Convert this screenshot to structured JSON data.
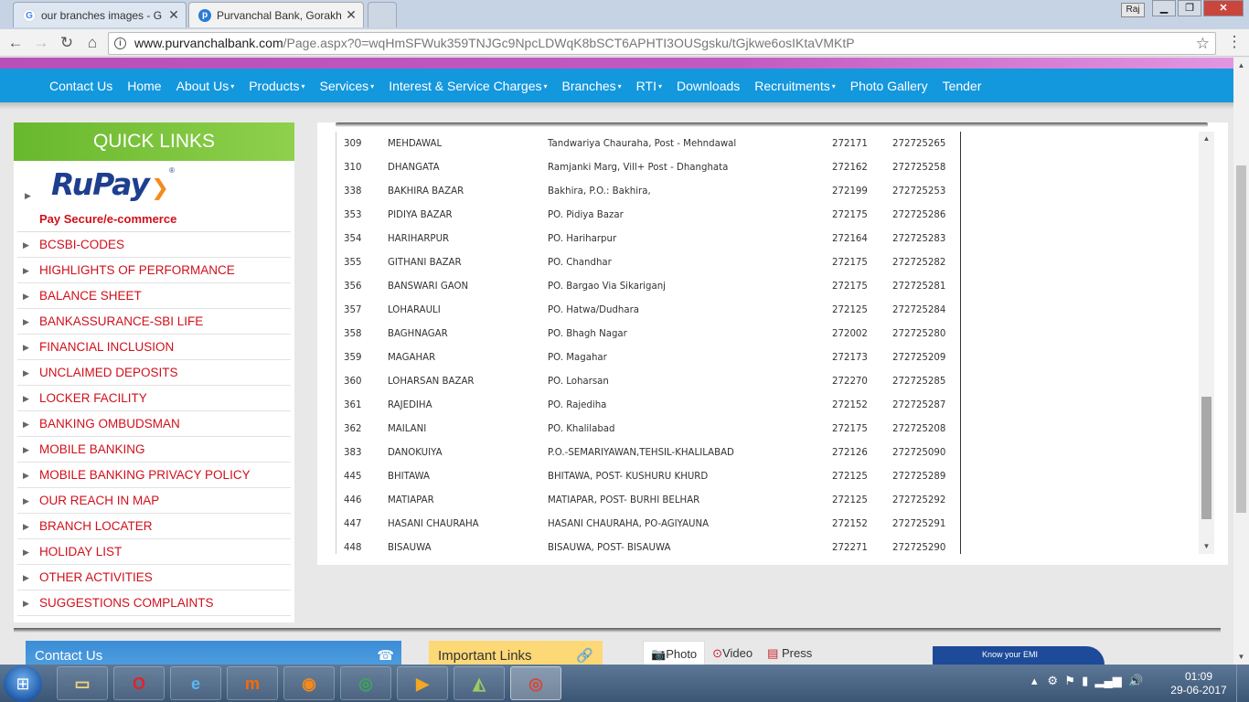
{
  "browser": {
    "tabs": [
      {
        "title": "our branches images - G",
        "favicon": "google-icon",
        "active": false
      },
      {
        "title": "Purvanchal Bank, Gorakh",
        "favicon": "pb-icon",
        "active": true
      }
    ],
    "profile": "Raj",
    "url_host": "www.purvanchalbank.com",
    "url_path": "/Page.aspx?0=wqHmSFWuk359TNJGc9NpcLDWqK8bSCT6APHTI3OUSgsku/tGjkwe6osIKtaVMKtP"
  },
  "nav": {
    "items": [
      {
        "label": "Contact Us",
        "dropdown": false
      },
      {
        "label": "Home",
        "dropdown": false
      },
      {
        "label": "About Us",
        "dropdown": true
      },
      {
        "label": "Products",
        "dropdown": true
      },
      {
        "label": "Services",
        "dropdown": true
      },
      {
        "label": "Interest & Service Charges",
        "dropdown": true
      },
      {
        "label": "Branches",
        "dropdown": true
      },
      {
        "label": "RTI",
        "dropdown": true
      },
      {
        "label": "Downloads",
        "dropdown": false
      },
      {
        "label": "Recruitments",
        "dropdown": true
      },
      {
        "label": "Photo Gallery",
        "dropdown": false
      },
      {
        "label": "Tender",
        "dropdown": false
      }
    ],
    "caret": "▾"
  },
  "quick_links": {
    "title": "QUICK LINKS",
    "rupay_logo": "RuPay",
    "rupay_caption": "Pay Secure/e-commerce",
    "items": [
      "BCSBI-CODES",
      "HIGHLIGHTS OF PERFORMANCE",
      "BALANCE SHEET",
      "BANKASSURANCE-SBI LIFE",
      "FINANCIAL INCLUSION",
      "UNCLAIMED DEPOSITS",
      "LOCKER FACILITY",
      "BANKING OMBUDSMAN",
      "MOBILE BANKING",
      "MOBILE BANKING PRIVACY POLICY",
      "OUR REACH IN MAP",
      "BRANCH LOCATER",
      "HOLIDAY LIST",
      "OTHER ACTIVITIES",
      "SUGGESTIONS COMPLAINTS"
    ]
  },
  "branches": [
    [
      "309",
      "MEHDAWAL",
      "Tandwariya Chauraha,  Post - Mehndawal",
      "272171",
      "272725265"
    ],
    [
      "310",
      "DHANGATA",
      "Ramjanki Marg, Vill+ Post - Dhanghata",
      "272162",
      "272725258"
    ],
    [
      "338",
      "BAKHIRA BAZAR",
      "Bakhira, P.O.: Bakhira,",
      "272199",
      "272725253"
    ],
    [
      "353",
      "PIDIYA BAZAR",
      "PO. Pidiya Bazar",
      "272175",
      "272725286"
    ],
    [
      "354",
      "HARIHARPUR",
      "PO. Hariharpur",
      "272164",
      "272725283"
    ],
    [
      "355",
      "GITHANI BAZAR",
      "PO. Chandhar",
      "272175",
      "272725282"
    ],
    [
      "356",
      "BANSWARI GAON",
      "PO. Bargao Via Sikariganj",
      "272175",
      "272725281"
    ],
    [
      "357",
      "LOHARAULI",
      "PO. Hatwa/Dudhara",
      "272125",
      "272725284"
    ],
    [
      "358",
      "BAGHNAGAR",
      "PO. Bhagh Nagar",
      "272002",
      "272725280"
    ],
    [
      "359",
      "MAGAHAR",
      "PO. Magahar",
      "272173",
      "272725209"
    ],
    [
      "360",
      "LOHARSAN BAZAR",
      "PO. Loharsan",
      "272270",
      "272725285"
    ],
    [
      "361",
      "RAJEDIHA",
      "PO. Rajediha",
      "272152",
      "272725287"
    ],
    [
      "362",
      "MAILANI",
      "PO. Khalilabad",
      "272175",
      "272725208"
    ],
    [
      "383",
      "DANOKUIYA",
      "P.O.-SEMARIYAWAN,TEHSIL-KHALILABAD",
      "272126",
      "272725090"
    ],
    [
      "445",
      "BHITAWA",
      " BHITAWA, POST- KUSHURU KHURD",
      "272125",
      "272725289"
    ],
    [
      "446",
      "MATIAPAR",
      " MATIAPAR, POST- BURHI BELHAR",
      "272125",
      "272725292"
    ],
    [
      "447",
      "HASANI CHAURAHA",
      " HASANI CHAURAHA, PO-AGIYAUNA",
      "272152",
      "272725291"
    ],
    [
      "448",
      "BISAUWA",
      " BISAUWA, POST- BISAUWA",
      "272271",
      "272725290"
    ]
  ],
  "footer": {
    "contact": "Contact Us",
    "important_links": "Important Links",
    "media_tabs": [
      "Photo",
      "Video",
      "Press"
    ],
    "emi": "Know your EMI"
  },
  "taskbar": {
    "time": "01:09",
    "date": "29-06-2017"
  },
  "colors": {
    "nav_blue": "#1397dd",
    "quick_links_green": "#68b82d",
    "link_red": "#d0101b"
  }
}
